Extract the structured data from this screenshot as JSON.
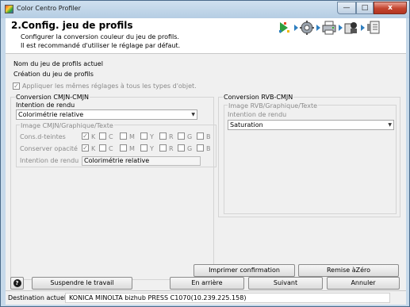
{
  "window": {
    "title": "Color Centro Profiler",
    "min_icon": "minimize-icon",
    "max_icon": "maximize-icon",
    "close_label": "x"
  },
  "header": {
    "title": "2.Config. jeu de profils",
    "desc_line1": "Configurer la conversion couleur du jeu de profils.",
    "desc_line2": "Il est recommandé d'utiliser le réglage par défaut.",
    "wizard_icons": [
      "hand-click-icon",
      "gear-icon",
      "printer-icon",
      "profile-icon",
      "export-icon"
    ]
  },
  "profile_set": {
    "name_label": "Nom du jeu de profils actuel",
    "creation_label": "Création du jeu de profils"
  },
  "apply_all": {
    "label": "Appliquer les mêmes réglages à tous les types d'objet.",
    "checked": true
  },
  "cmyk": {
    "group_label": "Conversion CMJN-CMJN",
    "intent_label": "Intention de rendu",
    "intent_value": "Colorimétrie relative",
    "image_group_label": "Image CMJN/Graphique/Texte",
    "rows": [
      {
        "label": "Cons.d-teintes",
        "checks": [
          {
            "ch": "K",
            "checked": true
          },
          {
            "ch": "C",
            "checked": false
          },
          {
            "ch": "M",
            "checked": false
          },
          {
            "ch": "Y",
            "checked": false
          },
          {
            "ch": "R",
            "checked": false
          },
          {
            "ch": "G",
            "checked": false
          },
          {
            "ch": "B",
            "checked": false
          }
        ]
      },
      {
        "label": "Conserver opacité",
        "checks": [
          {
            "ch": "K",
            "checked": true
          },
          {
            "ch": "C",
            "checked": false
          },
          {
            "ch": "M",
            "checked": false
          },
          {
            "ch": "Y",
            "checked": false
          },
          {
            "ch": "R",
            "checked": false
          },
          {
            "ch": "G",
            "checked": false
          },
          {
            "ch": "B",
            "checked": false
          }
        ]
      }
    ],
    "intent2_label": "Intention de rendu",
    "intent2_value": "Colorimétrie relative"
  },
  "rgb": {
    "group_label": "Conversion RVB-CMJN",
    "image_group_label": "Image RVB/Graphique/Texte",
    "intent_label": "Intention de rendu",
    "intent_value": "Saturation"
  },
  "buttons": {
    "print_confirm": "Imprimer confirmation",
    "reset": "Remise àZéro",
    "help_icon": "question-icon",
    "help_label": "?",
    "suspend": "Suspendre le travail",
    "back": "En arrière",
    "next": "Suivant",
    "cancel": "Annuler"
  },
  "status": {
    "label": "Destination actuelle",
    "value": "KONICA MINOLTA bizhub PRESS C1070(10.239.225.158)"
  }
}
